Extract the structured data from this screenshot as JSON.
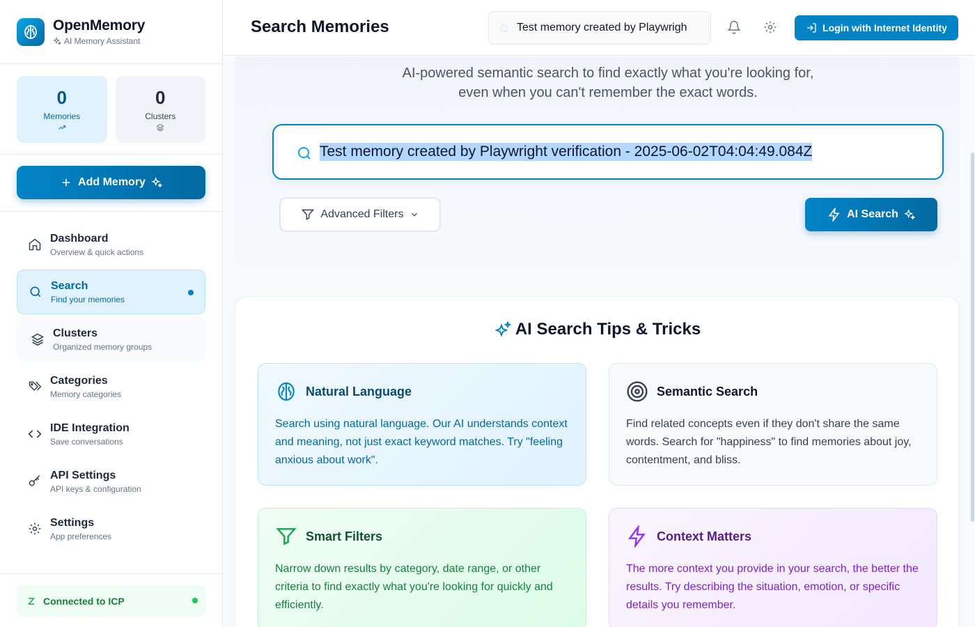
{
  "brand": {
    "title": "OpenMemory",
    "subtitle": "AI Memory Assistant"
  },
  "stats": {
    "memories": {
      "value": "0",
      "label": "Memories"
    },
    "clusters": {
      "value": "0",
      "label": "Clusters"
    }
  },
  "add_memory_label": "Add Memory",
  "nav": [
    {
      "title": "Dashboard",
      "subtitle": "Overview & quick actions",
      "icon": "home-icon"
    },
    {
      "title": "Search",
      "subtitle": "Find your memories",
      "icon": "search-icon",
      "active": true
    },
    {
      "title": "Clusters",
      "subtitle": "Organized memory groups",
      "icon": "layers-icon"
    },
    {
      "title": "Categories",
      "subtitle": "Memory categories",
      "icon": "tags-icon"
    },
    {
      "title": "IDE Integration",
      "subtitle": "Save conversations",
      "icon": "code-icon"
    },
    {
      "title": "API Settings",
      "subtitle": "API keys & configuration",
      "icon": "key-icon"
    },
    {
      "title": "Settings",
      "subtitle": "App preferences",
      "icon": "gear-icon"
    }
  ],
  "connection": {
    "label": "Connected to ICP",
    "status_color": "#22c55e"
  },
  "header": {
    "title": "Search Memories",
    "search_value": "Test memory created by Playwrigh",
    "login_label": "Login with Internet Identity"
  },
  "hero": {
    "description_line1": "AI-powered semantic search to find exactly what you're looking for,",
    "description_line2": "even when you can't remember the exact words.",
    "search_value": "Test memory created by Playwright verification - 2025-06-02T04:04:49.084Z",
    "advanced_filters_label": "Advanced Filters",
    "ai_search_label": "AI Search"
  },
  "tips": {
    "title": "AI Search Tips & Tricks",
    "cards": [
      {
        "title": "Natural Language",
        "icon": "brain-icon",
        "text": "Search using natural language. Our AI understands context and meaning, not just exact keyword matches. Try \"feeling anxious about work\"."
      },
      {
        "title": "Semantic Search",
        "icon": "target-icon",
        "text": "Find related concepts even if they don't share the same words. Search for \"happiness\" to find memories about joy, contentment, and bliss."
      },
      {
        "title": "Smart Filters",
        "icon": "filter-icon",
        "text": "Narrow down results by category, date range, or other criteria to find exactly what you're looking for quickly and efficiently."
      },
      {
        "title": "Context Matters",
        "icon": "zap-icon",
        "text": "The more context you provide in your search, the better the results. Try describing the situation, emotion, or specific details you remember."
      }
    ]
  },
  "colors": {
    "accent": "#0284c7",
    "accent_dark": "#0369a1",
    "green": "#15803d",
    "purple": "#7e22ce"
  }
}
